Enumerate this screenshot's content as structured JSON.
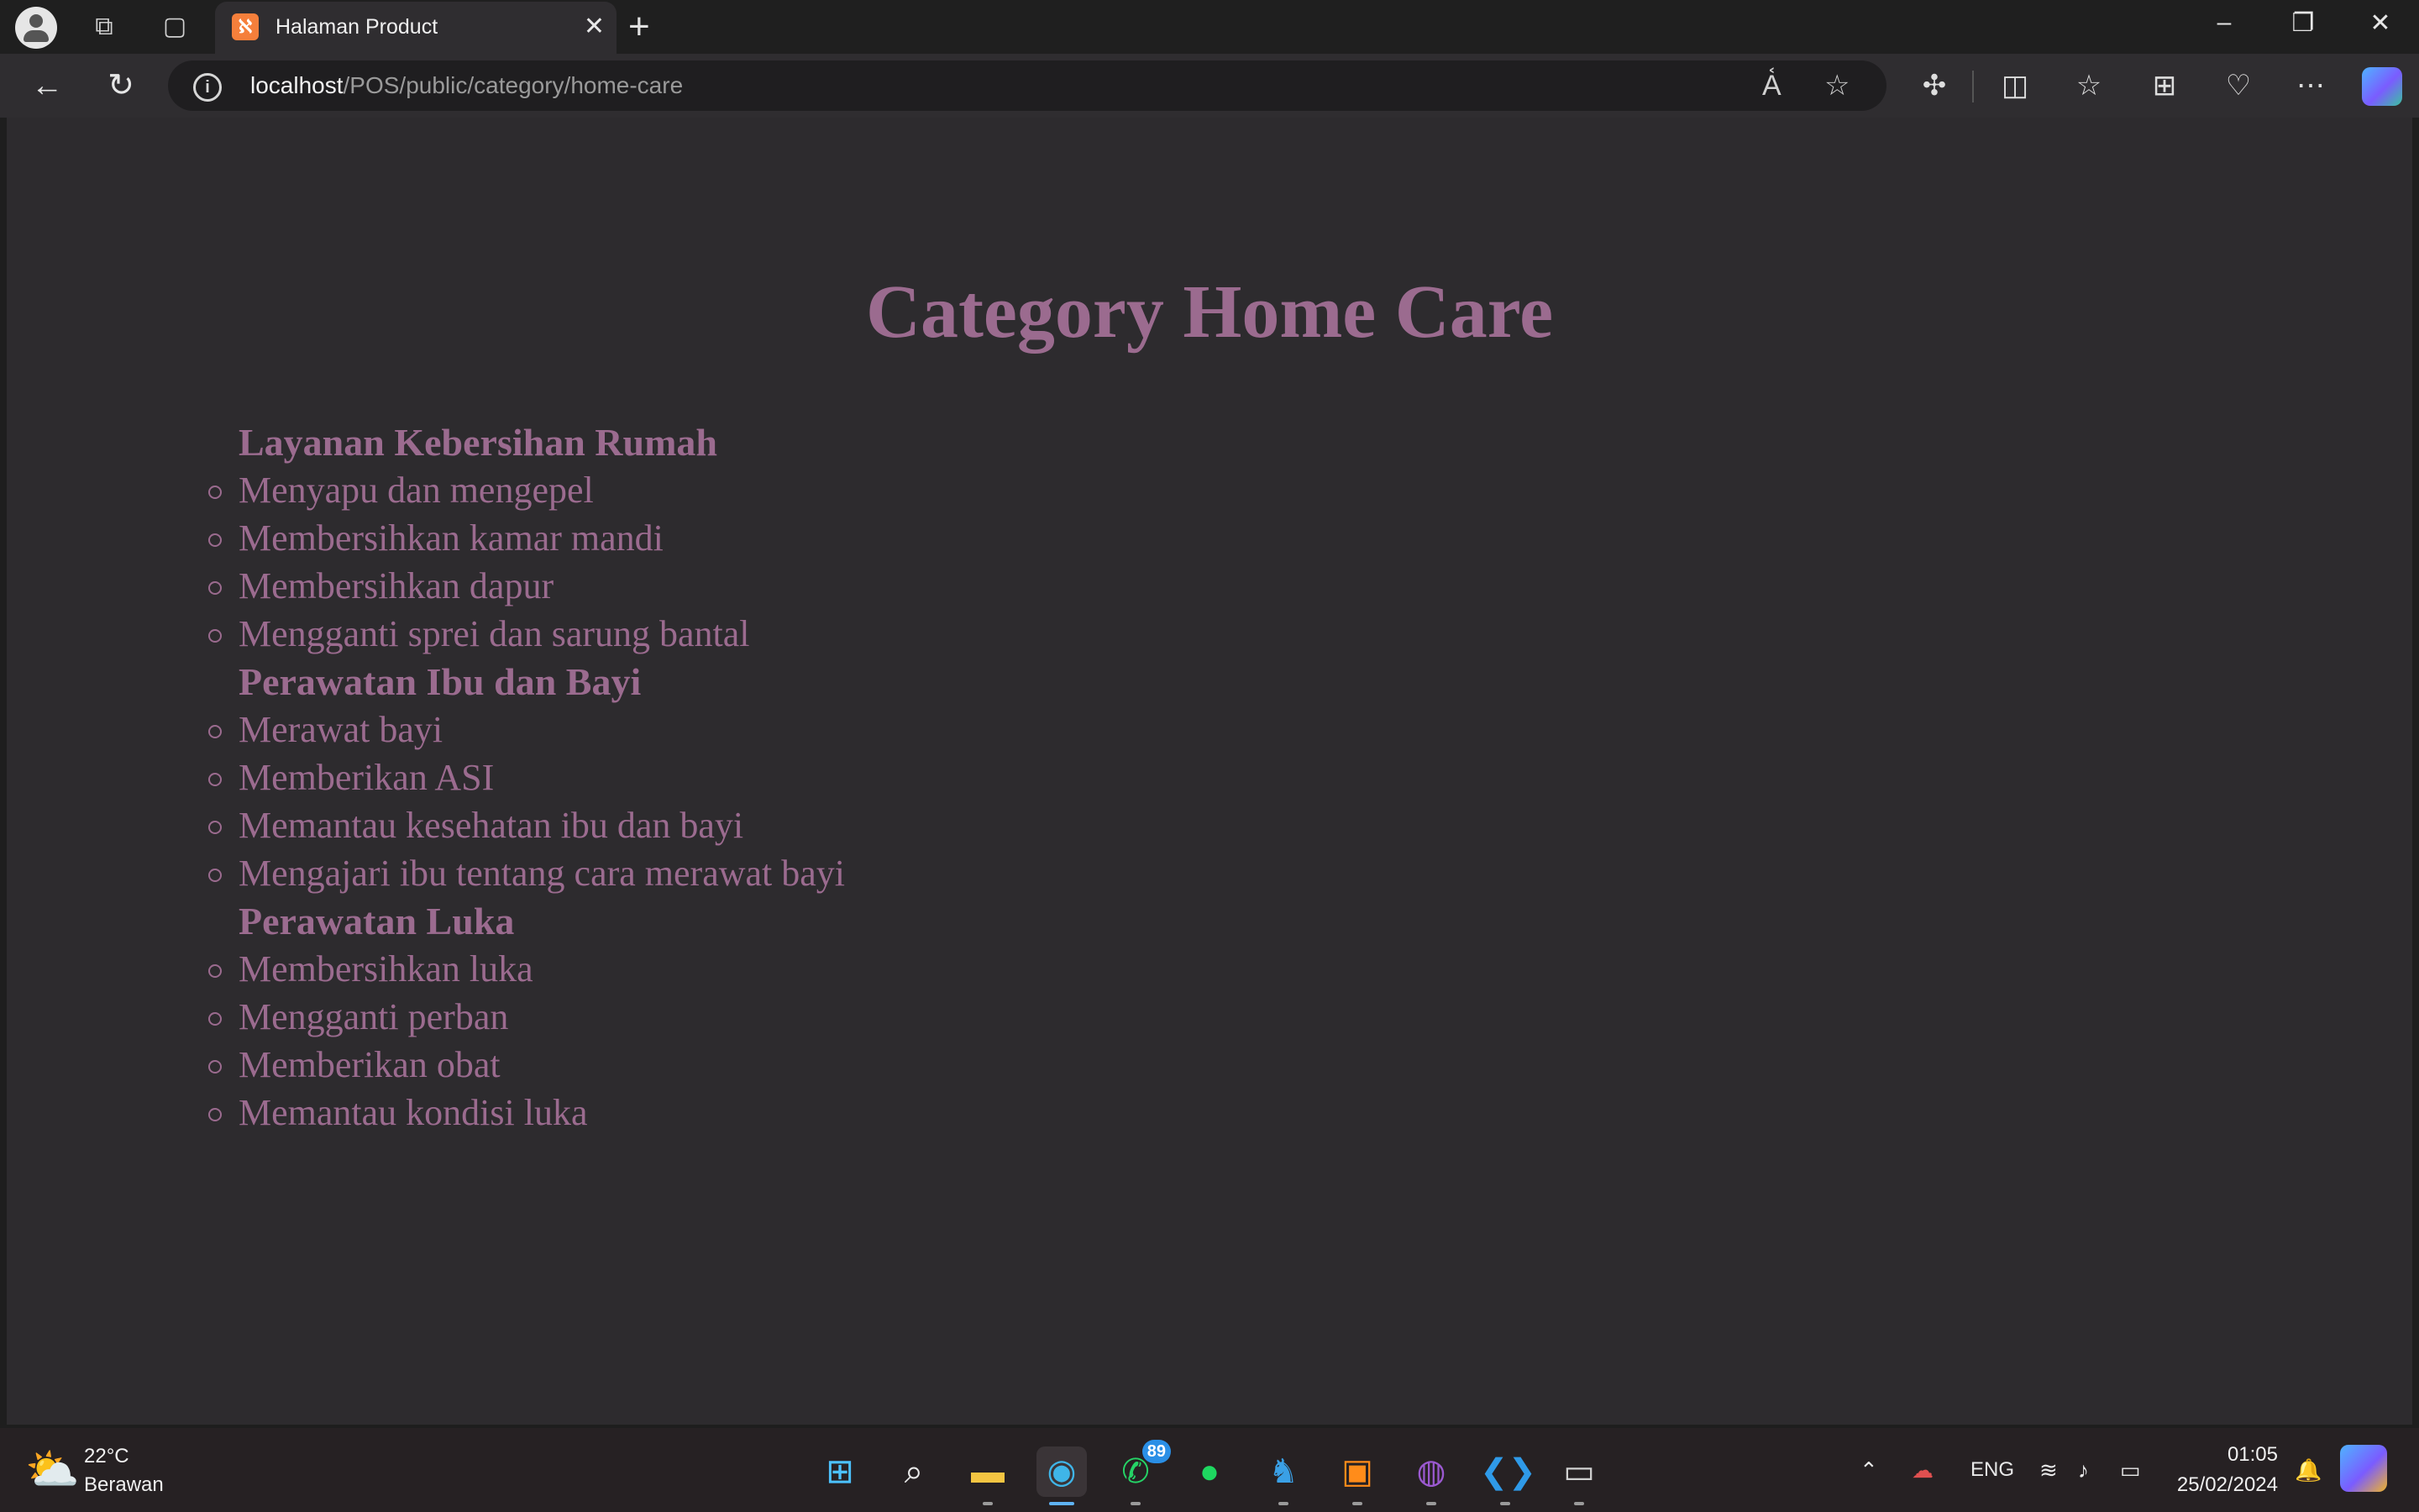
{
  "browser": {
    "tab_title": "Halaman Product",
    "url_host": "localhost",
    "url_path": "/POS/public/category/home-care",
    "new_tab_symbol": "+",
    "tab_close_symbol": "✕"
  },
  "page": {
    "title": "Category Home Care",
    "categories": [
      {
        "name": "Layanan Kebersihan Rumah",
        "items": [
          "Menyapu dan mengepel",
          "Membersihkan kamar mandi",
          "Membersihkan dapur",
          "Mengganti sprei dan sarung bantal"
        ]
      },
      {
        "name": "Perawatan Ibu dan Bayi",
        "items": [
          "Merawat bayi",
          "Memberikan ASI",
          "Memantau kesehatan ibu dan bayi",
          "Mengajari ibu tentang cara merawat bayi"
        ]
      },
      {
        "name": "Perawatan Luka",
        "items": [
          "Membersihkan luka",
          "Mengganti perban",
          "Memberikan obat",
          "Memantau kondisi luka"
        ]
      }
    ]
  },
  "taskbar": {
    "weather_temp": "22°C",
    "weather_desc": "Berawan",
    "whatsapp_badge": "89",
    "language": "ENG",
    "time": "01:05",
    "date": "25/02/2024"
  },
  "icons": {
    "tab_favicon": "xampp-icon",
    "weather": "partly-cloudy-icon"
  },
  "colors": {
    "accent_text": "#9b6b8f",
    "page_background": "#2d2b2e"
  }
}
